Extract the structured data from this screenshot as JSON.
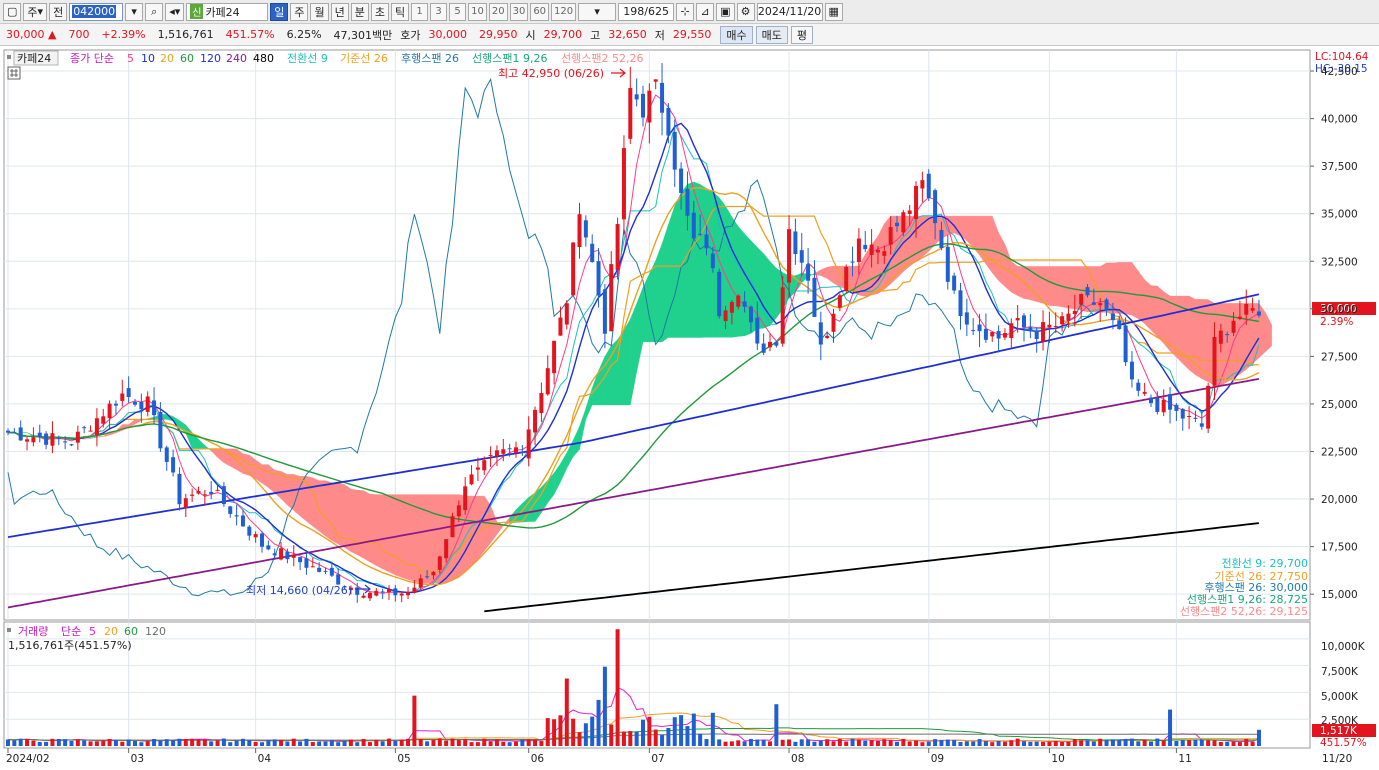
{
  "toolbar": {
    "market_type": "주",
    "period_label": "전",
    "stock_code": "042000",
    "stock_badge": "신",
    "stock_name": "카페24",
    "intervals": [
      "일",
      "주",
      "월",
      "년",
      "분",
      "초",
      "틱"
    ],
    "active_interval": "일",
    "minute_options": [
      "1",
      "3",
      "5",
      "10",
      "20",
      "30",
      "60",
      "120"
    ],
    "bar_count": "198/625",
    "date": "2024/11/20"
  },
  "info": {
    "price": "30,000",
    "change": "700",
    "change_rate": "+2.39%",
    "volume": "1,516,761",
    "volume_rate": "451.57%",
    "turnover": "6.25%",
    "amount": "47,301백만",
    "quote_label": "호가",
    "ask": "30,000",
    "bid": "29,950",
    "open_label": "시",
    "open": "29,700",
    "high_label": "고",
    "high": "32,650",
    "low_label": "저",
    "low": "29,550",
    "buy_label": "매수",
    "sell_label": "매도",
    "eval_label": "평"
  },
  "legend": {
    "stock_tag": "카페24",
    "close_ma_label": "종가 단순",
    "ma_periods": [
      "5",
      "10",
      "20",
      "60",
      "120",
      "240",
      "480"
    ],
    "ma_colors": [
      "#ff3a8c",
      "#1f2fd4",
      "#f0a020",
      "#1f9a3a",
      "#1f2fd4",
      "#8a1a8a",
      "#000000"
    ],
    "ichimoku": [
      {
        "label": "전환선 9",
        "color": "#19c2c2"
      },
      {
        "label": "기준선 26",
        "color": "#f0a020"
      },
      {
        "label": "후행스팬 26",
        "color": "#1f7aa8"
      },
      {
        "label": "선행스팬1 9,26",
        "color": "#19a878"
      },
      {
        "label": "선행스팬2 52,26",
        "color": "#ff8a8a"
      }
    ]
  },
  "annotations": {
    "high": "최고 42,950 (06/26)",
    "low": "최저 14,660 (04/26)"
  },
  "price_axis": {
    "lc": "LC:104.64",
    "hc": "HC:-30.15",
    "ticks": [
      "42,500",
      "40,000",
      "37,500",
      "35,000",
      "32,500",
      "30,000",
      "27,500",
      "25,000",
      "22,500",
      "20,000",
      "17,500",
      "15,000"
    ],
    "current_price": "30,000",
    "current_rate": "2.39%"
  },
  "ichimoku_values": [
    {
      "label": "전환선 9: 29,700",
      "color": "#19c2c2"
    },
    {
      "label": "기준선 26: 27,750",
      "color": "#f0a020"
    },
    {
      "label": "후행스팬 26: 30,000",
      "color": "#1f7aa8"
    },
    {
      "label": "선행스팬1 9,26: 28,725",
      "color": "#19a878"
    },
    {
      "label": "선행스팬2 52,26: 29,125",
      "color": "#ff8a8a"
    }
  ],
  "volume_panel": {
    "label": "거래량",
    "ma_label": "단순",
    "ma_periods": [
      "5",
      "20",
      "60",
      "120"
    ],
    "ma_colors": [
      "#e41ed6",
      "#f0a020",
      "#1f9a3a",
      "#6f6f6f"
    ],
    "value_line": "1,516,761주(451.57%)",
    "ticks": [
      "10,000K",
      "7,500K",
      "5,000K",
      "2,500K"
    ],
    "current_value": "1,517K",
    "current_rate": "451.57%"
  },
  "x_axis": {
    "labels": [
      "2024/02",
      "03",
      "04",
      "05",
      "06",
      "07",
      "08",
      "09",
      "10",
      "11",
      "11/20"
    ]
  },
  "colors": {
    "up": "#e4141e",
    "down": "#1f5fd4",
    "cloud_green": "#1fd18c",
    "cloud_red": "#ff8a8a"
  },
  "chart_data": {
    "type": "candlestick",
    "title": "카페24",
    "ylim": [
      13800,
      43500
    ],
    "volume_ylim": [
      0,
      11200
    ],
    "months": [
      "2024/02",
      "03",
      "04",
      "05",
      "06",
      "07",
      "08",
      "09",
      "10",
      "11"
    ],
    "anchors": [
      [
        0,
        23500
      ],
      [
        10,
        23000
      ],
      [
        18,
        25500
      ],
      [
        22,
        25000
      ],
      [
        27,
        20000
      ],
      [
        32,
        20500
      ],
      [
        40,
        17600
      ],
      [
        48,
        16400
      ],
      [
        55,
        15200
      ],
      [
        60,
        15000
      ],
      [
        63,
        15100
      ],
      [
        67,
        16200
      ],
      [
        72,
        20800
      ],
      [
        77,
        22300
      ],
      [
        81,
        22800
      ],
      [
        84,
        25800
      ],
      [
        88,
        30500
      ],
      [
        90,
        35500
      ],
      [
        94,
        29200
      ],
      [
        96,
        34500
      ],
      [
        98,
        41500
      ],
      [
        100,
        40600
      ],
      [
        102,
        41500
      ],
      [
        104,
        39800
      ],
      [
        106,
        35800
      ],
      [
        108,
        33500
      ],
      [
        110,
        33500
      ],
      [
        112,
        30000
      ],
      [
        115,
        31200
      ],
      [
        118,
        27800
      ],
      [
        121,
        28500
      ],
      [
        123,
        34200
      ],
      [
        126,
        31800
      ],
      [
        128,
        27800
      ],
      [
        131,
        31200
      ],
      [
        134,
        33800
      ],
      [
        137,
        33200
      ],
      [
        141,
        34800
      ],
      [
        144,
        36500
      ],
      [
        146,
        34800
      ],
      [
        149,
        30500
      ],
      [
        152,
        29200
      ],
      [
        156,
        28500
      ],
      [
        158,
        29200
      ],
      [
        162,
        28800
      ],
      [
        166,
        29200
      ],
      [
        169,
        30300
      ],
      [
        172,
        30300
      ],
      [
        175,
        28500
      ],
      [
        177,
        25800
      ],
      [
        180,
        25100
      ],
      [
        184,
        24500
      ],
      [
        188,
        23800
      ],
      [
        190,
        28200
      ],
      [
        193,
        29500
      ],
      [
        197,
        30000
      ]
    ],
    "series": [
      {
        "name": "종가",
        "values_ref": "candles"
      },
      {
        "name": "MA5"
      },
      {
        "name": "MA10"
      },
      {
        "name": "MA20"
      },
      {
        "name": "MA60"
      },
      {
        "name": "MA120"
      },
      {
        "name": "MA240"
      },
      {
        "name": "MA480"
      }
    ]
  }
}
